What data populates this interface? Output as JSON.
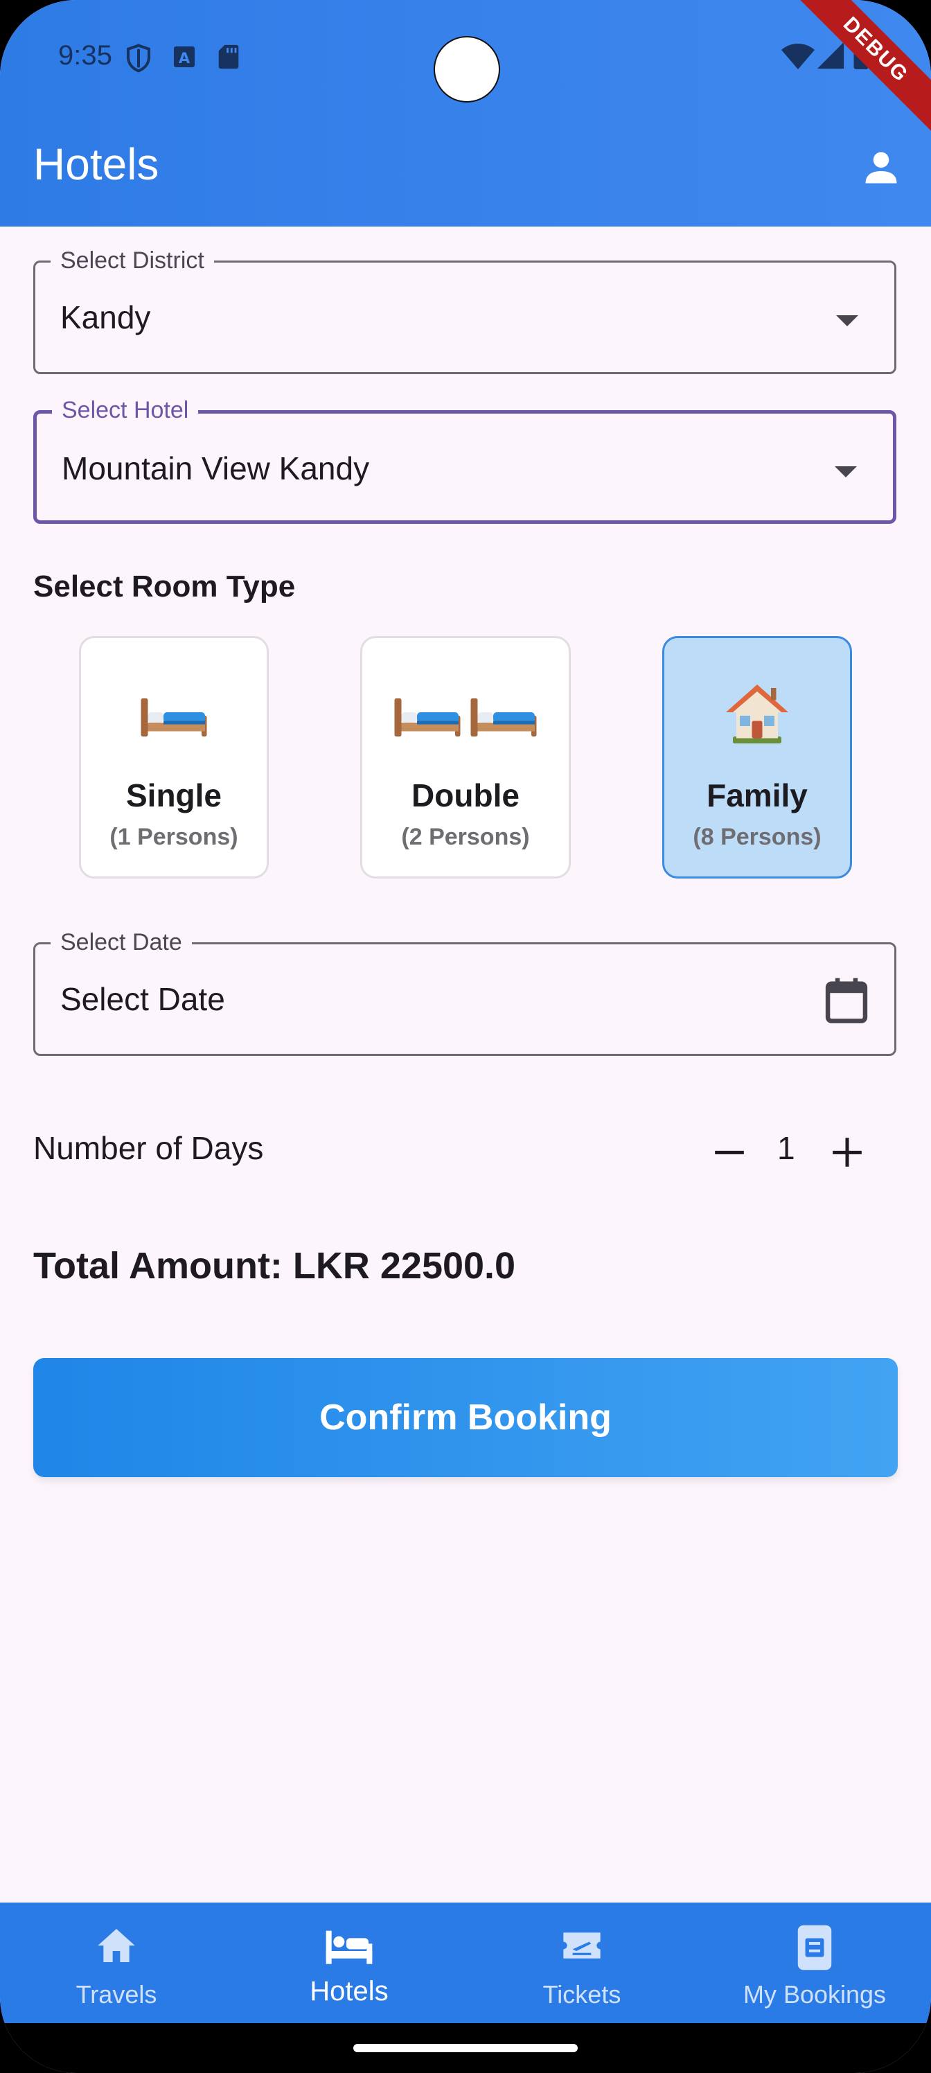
{
  "status_bar": {
    "time": "9:35",
    "debug_banner": "DEBUG"
  },
  "app_bar": {
    "title": "Hotels"
  },
  "district": {
    "label": "Select District",
    "value": "Kandy"
  },
  "hotel": {
    "label": "Select Hotel",
    "value": "Mountain View Kandy"
  },
  "room_section": {
    "title": "Select Room Type",
    "rooms": [
      {
        "name": "Single",
        "persons": "(1 Persons)",
        "icon": "bed-icon",
        "selected": false
      },
      {
        "name": "Double",
        "persons": "(2 Persons)",
        "icon": "double-bed-icon",
        "selected": false
      },
      {
        "name": "Family",
        "persons": "(8 Persons)",
        "icon": "house-icon",
        "selected": true
      }
    ]
  },
  "date": {
    "label": "Select Date",
    "value": "Select Date"
  },
  "days": {
    "label": "Number of Days",
    "value": "1"
  },
  "total": {
    "text": "Total Amount: LKR 22500.0"
  },
  "confirm": {
    "label": "Confirm Booking"
  },
  "bottom_nav": {
    "items": [
      {
        "label": "Travels",
        "icon": "home-icon",
        "active": false
      },
      {
        "label": "Hotels",
        "icon": "hotel-icon",
        "active": true
      },
      {
        "label": "Tickets",
        "icon": "ticket-icon",
        "active": false
      },
      {
        "label": "My Bookings",
        "icon": "bookings-icon",
        "active": false
      }
    ]
  },
  "colors": {
    "primary": "#2f7be6",
    "selected_card": "#bcdcf8",
    "focus_border": "#6b56a8",
    "background": "#fcf5fb"
  }
}
